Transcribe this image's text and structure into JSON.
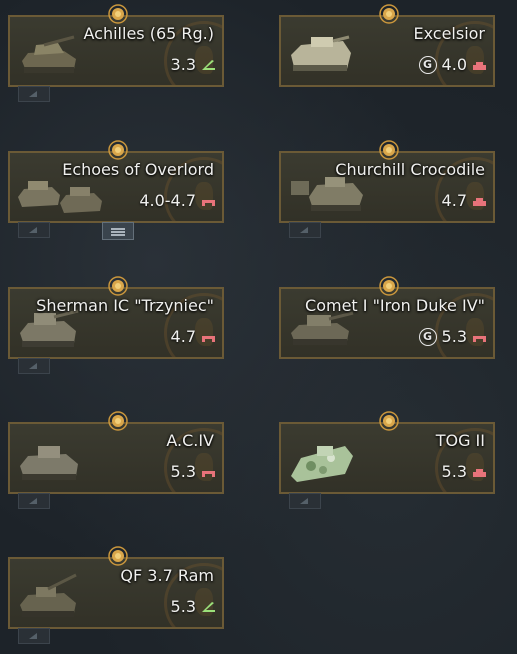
{
  "vehicles": [
    {
      "name": "Achilles (65 Rg.)",
      "br": "3.3",
      "role": "tank-destroyer-icon",
      "premium": false
    },
    {
      "name": "Excelsior",
      "br": "4.0",
      "role": "heavy-tank-icon",
      "premium": true
    },
    {
      "name": "Echoes of Overlord",
      "br": "4.0-4.7",
      "role": "medium-tank-icon",
      "premium": false,
      "group": true
    },
    {
      "name": "Churchill Crocodile",
      "br": "4.7",
      "role": "heavy-tank-icon",
      "premium": false
    },
    {
      "name": "Sherman IC \"Trzyniec\"",
      "br": "4.7",
      "role": "medium-tank-icon",
      "premium": false
    },
    {
      "name": "Comet I \"Iron Duke IV\"",
      "br": "5.3",
      "role": "medium-tank-icon",
      "premium": true
    },
    {
      "name": "A.C.IV",
      "br": "5.3",
      "role": "medium-tank-icon",
      "premium": false
    },
    {
      "name": "TOG II",
      "br": "5.3",
      "role": "heavy-tank-icon",
      "premium": false
    },
    {
      "name": "QF 3.7 Ram",
      "br": "5.3",
      "role": "tank-destroyer-icon",
      "premium": false
    }
  ],
  "colors": {
    "card_border": "#6b5a36",
    "medium_tank": "#e8737a",
    "heavy_tank": "#e8737a",
    "tank_destroyer": "#9be07a",
    "medal": "#d9a64a"
  }
}
